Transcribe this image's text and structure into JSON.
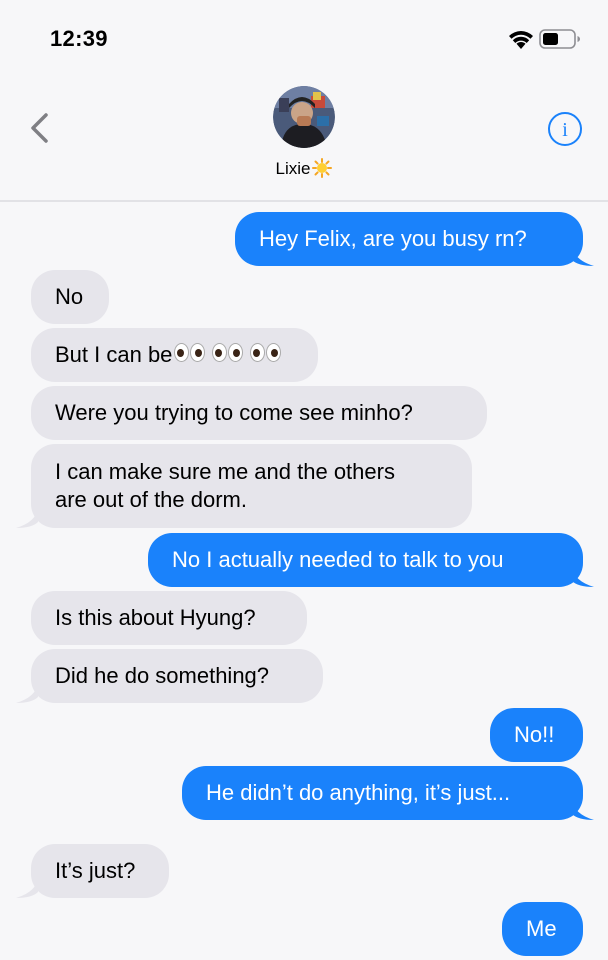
{
  "status_bar": {
    "time": "12:39"
  },
  "contact": {
    "name": "Lixie"
  },
  "messages": [
    {
      "from": "me",
      "text": "Hey Felix, are you busy rn?"
    },
    {
      "from": "them",
      "text": "No"
    },
    {
      "from": "them",
      "text": "But I can be"
    },
    {
      "from": "them",
      "text": "Were you trying to come see minho?"
    },
    {
      "from": "them",
      "lines": [
        "I can make sure me and the others",
        "are out of the dorm."
      ]
    },
    {
      "from": "me",
      "text": "No I actually needed to talk to you"
    },
    {
      "from": "them",
      "text": "Is this about Hyung?"
    },
    {
      "from": "them",
      "text": "Did he do something?"
    },
    {
      "from": "me",
      "text": "No!!"
    },
    {
      "from": "me",
      "text": "He didn’t do anything, it’s just..."
    },
    {
      "from": "them",
      "text": "It’s just?"
    },
    {
      "from": "me",
      "text": "Me"
    }
  ],
  "colors": {
    "outgoing": "#1a82fb",
    "incoming": "#e6e5eb",
    "accent": "#1a82fb"
  },
  "icons": [
    "wifi-icon",
    "battery-icon",
    "back-chevron-icon",
    "info-icon",
    "sun-emoji",
    "eyes-emoji"
  ]
}
